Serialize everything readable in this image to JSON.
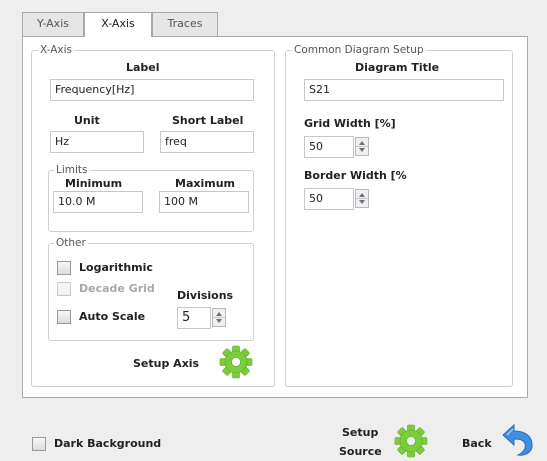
{
  "tabs": [
    {
      "label": "Y-Axis"
    },
    {
      "label": "X-Axis"
    },
    {
      "label": "Traces"
    }
  ],
  "xaxis": {
    "group_title": "X-Axis",
    "label_title": "Label",
    "label_value": "Frequency[Hz]",
    "unit_title": "Unit",
    "unit_value": "Hz",
    "short_label_title": "Short Label",
    "short_label_value": "freq",
    "limits": {
      "group_title": "Limits",
      "minimum_title": "Minimum",
      "minimum_value": "10.0 M",
      "maximum_title": "Maximum",
      "maximum_value": "100 M"
    },
    "other": {
      "group_title": "Other",
      "logarithmic_label": "Logarithmic",
      "decade_grid_label": "Decade Grid",
      "auto_scale_label": "Auto Scale",
      "divisions_title": "Divisions",
      "divisions_value": "5"
    },
    "setup_axis_label": "Setup Axis"
  },
  "diagram": {
    "group_title": "Common Diagram Setup",
    "title_title": "Diagram Title",
    "title_value": "S21",
    "grid_width_title": "Grid Width [%]",
    "grid_width_value": "50",
    "border_width_title": "Border Width [%",
    "border_width_value": "50"
  },
  "footer": {
    "dark_background_label": "Dark Background",
    "setup_source_line1": "Setup",
    "setup_source_line2": "Source",
    "back_label": "Back"
  },
  "colors": {
    "gear": "#7ccd3a",
    "back_arrow": "#3f8fe0"
  },
  "icons": {
    "setup_axis": "gear-icon",
    "setup_source": "gear-icon",
    "back": "back-arrow-icon"
  }
}
